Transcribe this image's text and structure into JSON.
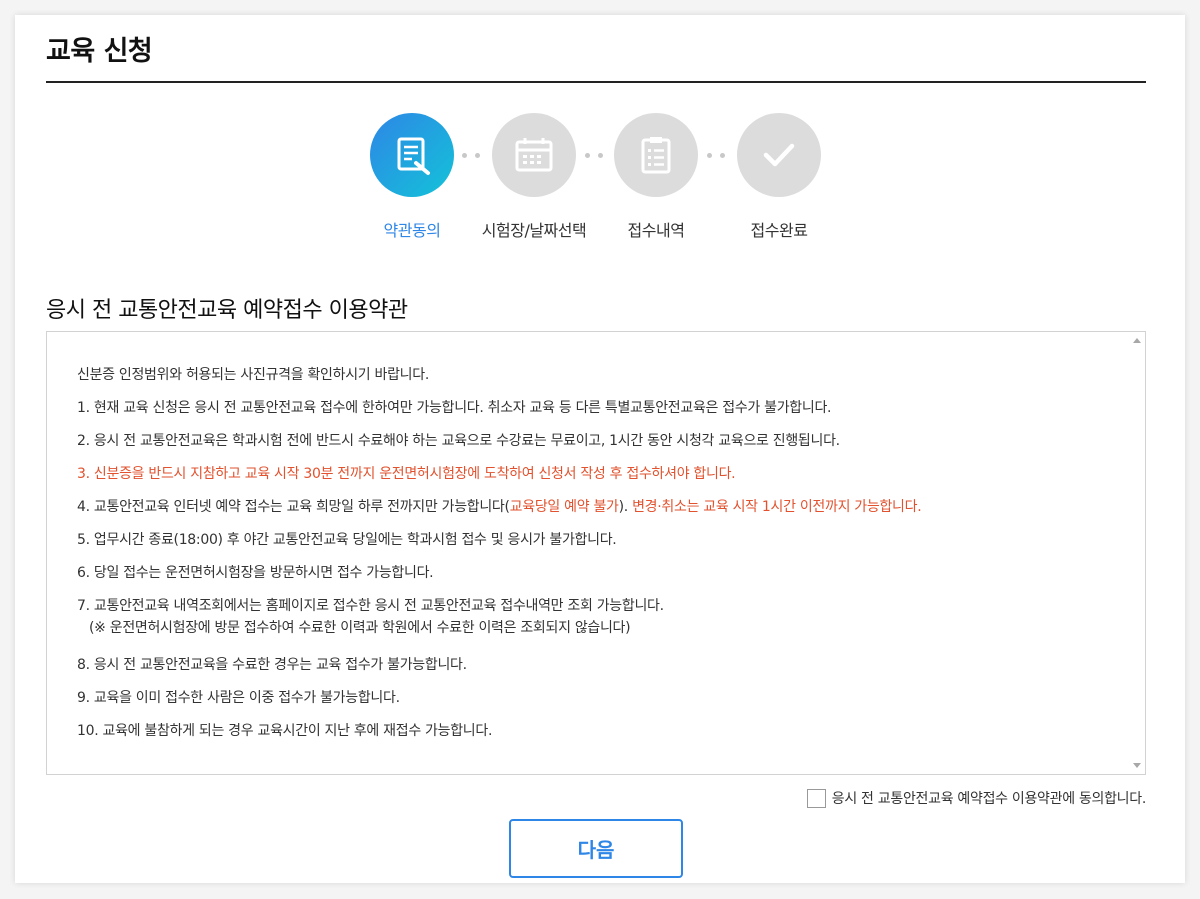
{
  "page": {
    "title": "교육 신청"
  },
  "steps": [
    {
      "label": "약관동의",
      "icon": "document-pen-icon",
      "active": true
    },
    {
      "label": "시험장/날짜선택",
      "icon": "calendar-icon",
      "active": false
    },
    {
      "label": "접수내역",
      "icon": "clipboard-icon",
      "active": false
    },
    {
      "label": "접수완료",
      "icon": "check-icon",
      "active": false
    }
  ],
  "section": {
    "title": "응시 전 교통안전교육 예약접수 이용약관"
  },
  "terms": {
    "intro": "신분증 인정범위와 허용되는 사진규격을 확인하시기 바랍니다.",
    "item1": "1. 현재 교육 신청은 응시 전 교통안전교육 접수에 한하여만 가능합니다. 취소자 교육 등 다른 특별교통안전교육은 접수가 불가합니다.",
    "item2": "2. 응시 전 교통안전교육은 학과시험 전에 반드시 수료해야 하는 교육으로 수강료는 무료이고, 1시간 동안 시청각 교육으로 진행됩니다.",
    "item3": "3. 신분증을 반드시 지참하고 교육 시작 30분 전까지 운전면허시험장에 도착하여 신청서 작성 후 접수하셔야 합니다.",
    "item4_a": "4. 교통안전교육 인터넷 예약 접수는 교육 희망일 하루 전까지만 가능합니다(",
    "item4_b": "교육당일 예약 불가",
    "item4_c": "). ",
    "item4_d": "변경·취소는 교육 시작 1시간 이전까지 가능합니다.",
    "item5": "5. 업무시간 종료(18:00) 후 야간 교통안전교육 당일에는 학과시험 접수 및 응시가 불가합니다.",
    "item6": "6. 당일 접수는 운전면허시험장을 방문하시면 접수 가능합니다.",
    "item7": "7. 교통안전교육 내역조회에서는 홈페이지로 접수한 응시 전 교통안전교육 접수내역만 조회 가능합니다.",
    "item7_note": "(※ 운전면허시험장에 방문 접수하여 수료한 이력과 학원에서 수료한 이력은 조회되지 않습니다)",
    "item8": "8. 응시 전 교통안전교육을 수료한 경우는 교육 접수가 불가능합니다.",
    "item9": "9. 교육을 이미 접수한 사람은 이중 접수가 불가능합니다.",
    "item10": "10. 교육에 불참하게 되는 경우 교육시간이 지난 후에 재접수 가능합니다."
  },
  "agree": {
    "label": "응시 전 교통안전교육 예약접수 이용약관에 동의합니다.",
    "checked": false
  },
  "buttons": {
    "next": "다음"
  },
  "colors": {
    "accent": "#2e86e6",
    "accent_end": "#13c3d8",
    "warning": "#e2522e",
    "inactive": "#dcdcdc"
  }
}
